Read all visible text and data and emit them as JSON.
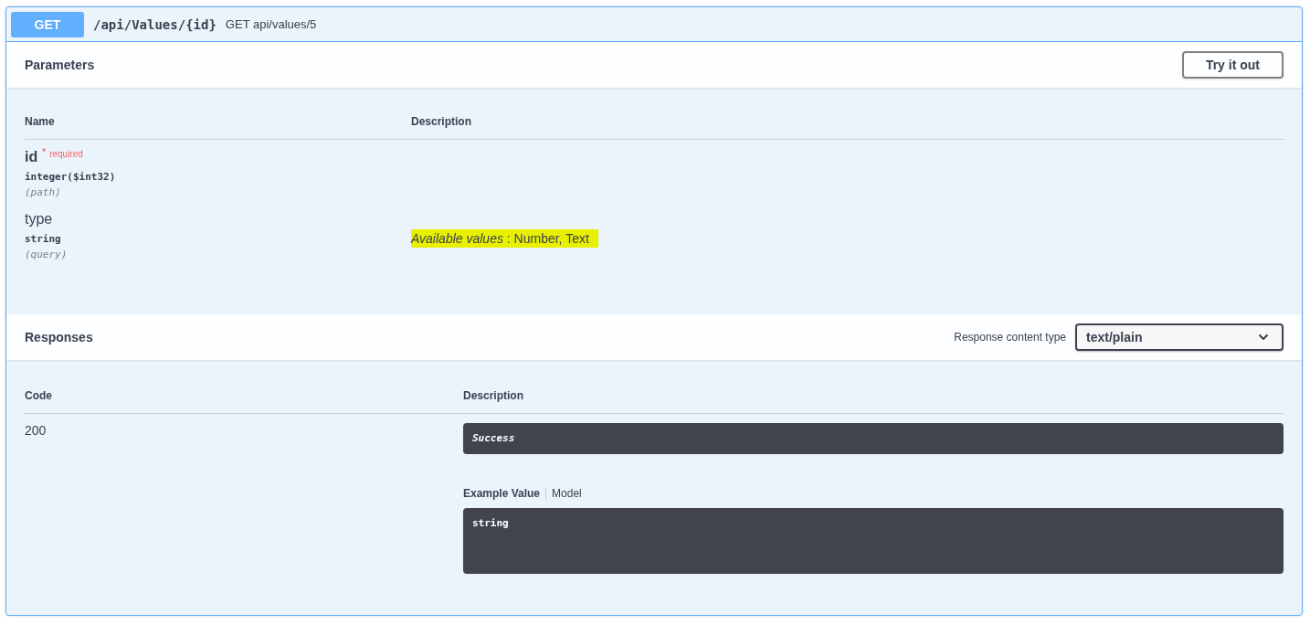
{
  "operation": {
    "method": "GET",
    "path": "/api/Values/{id}",
    "summary": "GET api/values/5"
  },
  "parameters": {
    "title": "Parameters",
    "try_button": "Try it out",
    "columns": [
      "Name",
      "Description"
    ],
    "rows": [
      {
        "name": "id",
        "required_mark": "*",
        "required_label": "required",
        "type": "integer($int32)",
        "location": "(path)"
      },
      {
        "name": "type",
        "type": "string",
        "location": "(query)",
        "description": "*Available values* : Number, Text",
        "highlighted": true
      }
    ]
  },
  "responses": {
    "title": "Responses",
    "content_type_label": "Response content type",
    "content_type": "text/plain",
    "columns": [
      "Code",
      "Description"
    ],
    "rows": [
      {
        "code": "200",
        "description": "Success",
        "example_tabs": [
          {
            "label": "Example Value",
            "selected": true
          },
          {
            "label": "Model",
            "selected": false
          }
        ],
        "example": "string"
      }
    ]
  }
}
